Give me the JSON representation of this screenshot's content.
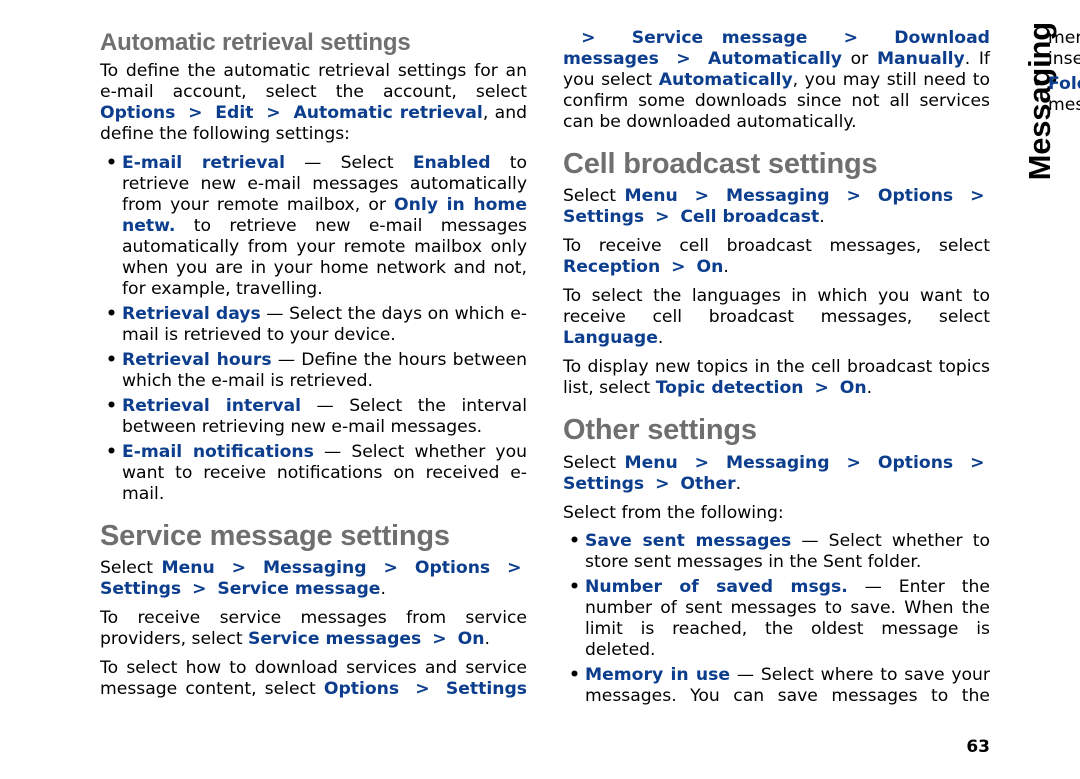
{
  "sideTab": "Messaging",
  "pageNumber": "63",
  "auto": {
    "heading": "Automatic retrieval settings",
    "intro_pre": "To define the automatic retrieval settings for an e-mail account, select the account, select ",
    "intro_opt": "Options",
    "intro_edit": "Edit",
    "intro_autoretr": "Automatic retrieval",
    "intro_post": ", and define the following settings:",
    "items": {
      "emailRetrieval": {
        "term": "E-mail retrieval",
        "pre": " — Select ",
        "enabled": "Enabled",
        "mid1": " to retrieve new e-mail messages automatically from your remote mailbox, or ",
        "only": "Only in home netw.",
        "post": " to retrieve new e-mail messages automatically from your remote mailbox only when you are in your home network and not, for example, travelling."
      },
      "retrievalDays": {
        "term": "Retrieval days",
        "desc": " — Select the days on which e-mail is retrieved to your device."
      },
      "retrievalHours": {
        "term": "Retrieval hours",
        "desc": " — Define the hours between which the e-mail is retrieved."
      },
      "retrievalInterval": {
        "term": "Retrieval interval",
        "desc": " — Select the interval between retrieving new e-mail messages."
      },
      "emailNotif": {
        "term": "E-mail notifications",
        "desc": " — Select whether you want to receive notifications on received e-mail."
      }
    }
  },
  "service": {
    "heading": "Service message settings",
    "nav": {
      "pre": "Select ",
      "menu": "Menu",
      "messaging": "Messaging",
      "options": "Options",
      "settings": "Settings",
      "last": "Service message",
      "dot": "."
    },
    "receive": {
      "pre": "To receive service messages from service providers, select ",
      "sm": "Service messages",
      "on": "On",
      "dot": "."
    },
    "howto": {
      "pre": "To select how to download services and service message content, select ",
      "options": "Options",
      "settings": "Settings",
      "sm": "Service message",
      "dl": "Download messages",
      "auto": "Automatically",
      "or": " or ",
      "man": "Manually",
      "tail1": ". If you select ",
      "tail2": ", you may still need to confirm some downloads since not all services can be downloaded automatically."
    }
  },
  "cell": {
    "heading": "Cell broadcast settings",
    "nav": {
      "pre": "Select ",
      "menu": "Menu",
      "messaging": "Messaging",
      "options": "Options",
      "settings": "Settings",
      "last": "Cell broadcast",
      "dot": "."
    },
    "receive": {
      "pre": "To receive cell broadcast messages, select ",
      "reception": "Reception",
      "on": "On",
      "dot": "."
    },
    "lang": {
      "pre": "To select the languages in which you want to receive cell broadcast messages, select ",
      "language": "Language",
      "dot": "."
    },
    "topic": {
      "pre": "To display new topics in the cell broadcast topics list, select ",
      "td": "Topic detection",
      "on": "On",
      "dot": "."
    }
  },
  "other": {
    "heading": "Other settings",
    "nav": {
      "pre": "Select ",
      "menu": "Menu",
      "messaging": "Messaging",
      "options": "Options",
      "settings": "Settings",
      "last": "Other",
      "dot": "."
    },
    "selectFrom": "Select from the following:",
    "items": {
      "save": {
        "term": "Save sent messages",
        "desc": " — Select whether to store sent messages in the Sent folder."
      },
      "num": {
        "term": "Number of saved msgs.",
        "desc": " — Enter the number of sent messages to save. When the limit is reached, the oldest message is deleted."
      },
      "mem": {
        "term": "Memory in use",
        "desc": " — Select where to save your messages. You can save messages to the memory card only if a memory card is inserted."
      },
      "folder": {
        "term": "Folder view",
        "desc": " — Define how you want the messages in Inbox to be shown."
      }
    }
  },
  "gt": ">"
}
